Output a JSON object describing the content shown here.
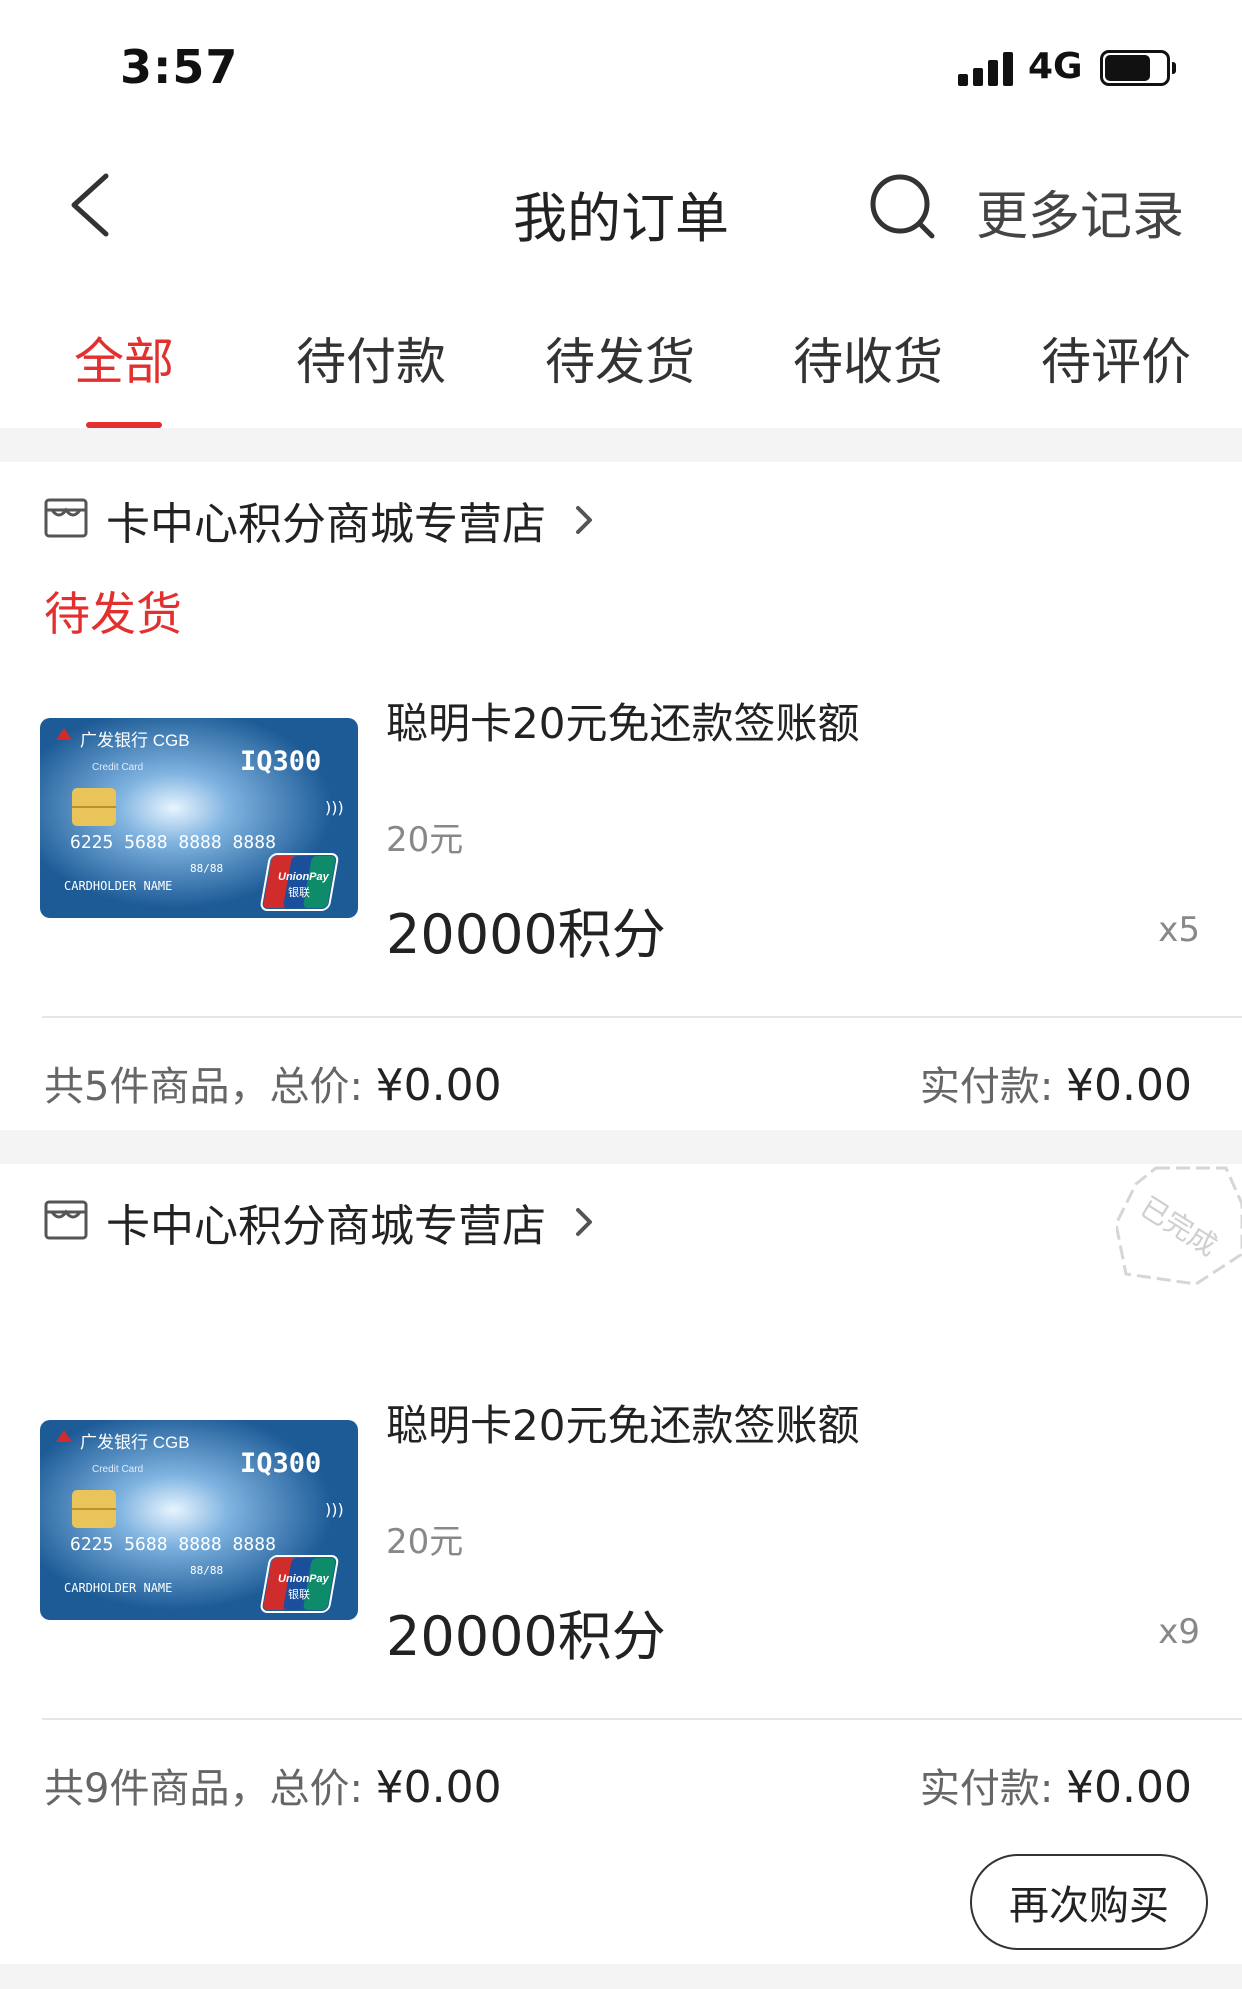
{
  "status_bar": {
    "time": "3:57",
    "network": "4G",
    "battery_level": 0.75
  },
  "nav": {
    "title": "我的订单",
    "more_records": "更多记录"
  },
  "tabs": [
    {
      "label": "全部",
      "active": true
    },
    {
      "label": "待付款",
      "active": false
    },
    {
      "label": "待发货",
      "active": false
    },
    {
      "label": "待收货",
      "active": false
    },
    {
      "label": "待评价",
      "active": false
    }
  ],
  "orders": [
    {
      "store": "卡中心积分商城专营店",
      "status": "待发货",
      "product": {
        "title": "聪明卡20元免还款签账额",
        "spec": "20元",
        "price": "20000积分",
        "qty": "x5",
        "image": {
          "bank": "广发银行 CGB",
          "credit": "Credit Card",
          "model": "IQ300",
          "number": "6225 5688 8888 8888",
          "expiry": "88/88",
          "holder": "CARDHOLDER NAME",
          "network": "UnionPay",
          "network_cn": "银联"
        }
      },
      "summary": {
        "count_text": "共5件商品，总价:",
        "total": "¥0.00",
        "paid_label": "实付款:",
        "paid": "¥0.00"
      }
    },
    {
      "store": "卡中心积分商城专营店",
      "stamp": "已完成",
      "product": {
        "title": "聪明卡20元免还款签账额",
        "spec": "20元",
        "price": "20000积分",
        "qty": "x9",
        "image": {
          "bank": "广发银行 CGB",
          "credit": "Credit Card",
          "model": "IQ300",
          "number": "6225 5688 8888 8888",
          "expiry": "88/88",
          "holder": "CARDHOLDER NAME",
          "network": "UnionPay",
          "network_cn": "银联"
        }
      },
      "summary": {
        "count_text": "共9件商品，总价:",
        "total": "¥0.00",
        "paid_label": "实付款:",
        "paid": "¥0.00"
      },
      "action": "再次购买"
    }
  ],
  "colors": {
    "accent": "#e2302f",
    "gap": "#f4f4f5",
    "card_blue": "#1d5b96"
  }
}
